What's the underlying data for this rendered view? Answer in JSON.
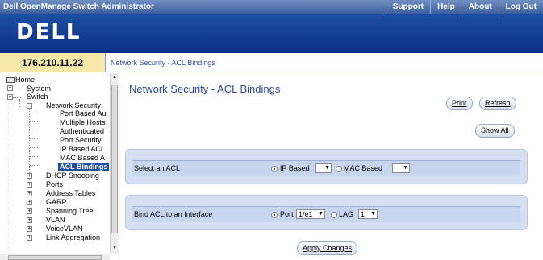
{
  "app": {
    "title": "Dell OpenManage Switch Administrator",
    "logo": "DELL"
  },
  "topnav": [
    "Support",
    "Help",
    "About",
    "Log Out"
  ],
  "address": {
    "ip": "176.210.11.22",
    "breadcrumb": "Network Security - ACL Bindings"
  },
  "tree": {
    "items": [
      {
        "label": "Home",
        "icon": "home-folder-icon"
      },
      {
        "label": "System"
      },
      {
        "label": "Switch"
      },
      {
        "label": "Network Security"
      },
      {
        "label": "Port Based Au"
      },
      {
        "label": "Multiple Hosts"
      },
      {
        "label": "Authenticated"
      },
      {
        "label": "Port Security"
      },
      {
        "label": "IP Based ACL"
      },
      {
        "label": "MAC Based A"
      },
      {
        "label": "ACL Bindings",
        "selected": true
      },
      {
        "label": "DHCP Snooping"
      },
      {
        "label": "Ports"
      },
      {
        "label": "Address Tables"
      },
      {
        "label": "GARP"
      },
      {
        "label": "Spanning Tree"
      },
      {
        "label": "VLAN"
      },
      {
        "label": "VoiceVLAN"
      },
      {
        "label": "Link Aggregation"
      }
    ]
  },
  "main": {
    "title": "Network Security - ACL Bindings",
    "buttons": {
      "print": "Print",
      "refresh": "Refresh",
      "show_all": "Show All",
      "apply": "Apply Changes"
    },
    "select_acl": {
      "label": "Select an ACL",
      "ip_option": "IP Based",
      "mac_option": "MAC Based",
      "selected": "IP Based"
    },
    "bind": {
      "label": "Bind ACL to an Interface",
      "port_option": "Port",
      "port_value": "1/e1",
      "lag_option": "LAG",
      "lag_value": "1",
      "selected": "Port"
    }
  },
  "colors": {
    "brand_blue": "#0a2f82",
    "panel_bg": "#d7e0f3",
    "ip_box": "#f6e8a8",
    "title_blue": "#2a4a97"
  }
}
